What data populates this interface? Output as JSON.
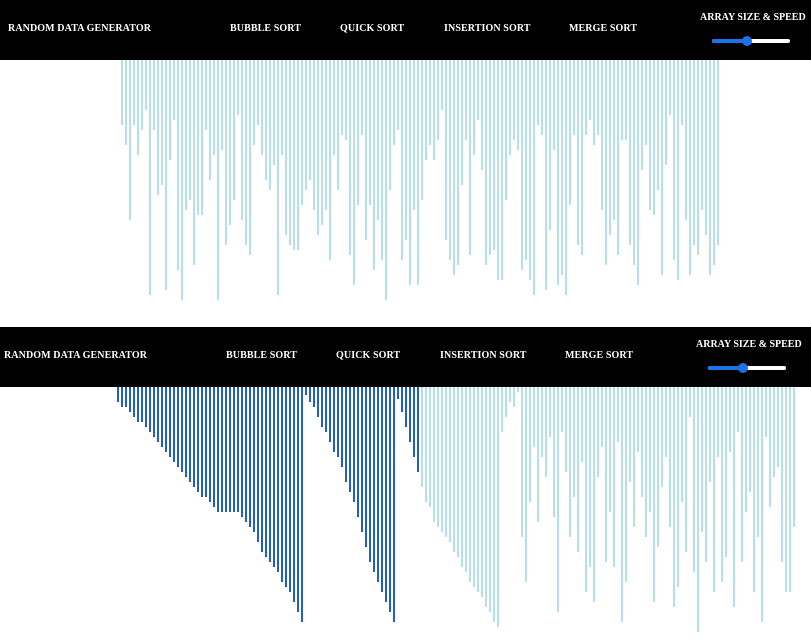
{
  "colors": {
    "navbar_bg": "#000000",
    "nav_text": "#ffffff",
    "bar_unsorted": "#b5e0ea",
    "bar_sorted": "#1f5fc6",
    "slider_accent": "#1a73e8",
    "slider_track": "#ffffff"
  },
  "nav": {
    "generator_label": "RANDOM DATA GENERATOR",
    "bubble_label": "BUBBLE SORT",
    "quick_label": "QUICK SORT",
    "insertion_label": "INSERTION SORT",
    "merge_label": "MERGE SORT",
    "controls_label": "ARRAY SIZE & SPEED"
  },
  "panels": [
    {
      "slider_value": 0.45,
      "sorted_count": 0,
      "bars": [
        65,
        85,
        160,
        65,
        95,
        70,
        50,
        235,
        70,
        135,
        125,
        230,
        100,
        60,
        210,
        240,
        150,
        140,
        205,
        155,
        155,
        70,
        120,
        95,
        240,
        90,
        185,
        165,
        140,
        55,
        160,
        185,
        195,
        85,
        65,
        95,
        120,
        130,
        105,
        235,
        95,
        175,
        185,
        190,
        190,
        145,
        130,
        120,
        150,
        175,
        165,
        150,
        200,
        95,
        130,
        75,
        80,
        195,
        225,
        145,
        75,
        180,
        145,
        210,
        160,
        200,
        240,
        130,
        85,
        70,
        200,
        180,
        225,
        150,
        225,
        140,
        100,
        85,
        100,
        80,
        50,
        180,
        200,
        215,
        205,
        125,
        80,
        195,
        95,
        60,
        110,
        205,
        195,
        190,
        220,
        220,
        140,
        95,
        80,
        90,
        210,
        200,
        220,
        235,
        65,
        75,
        230,
        170,
        90,
        225,
        215,
        235,
        145,
        75,
        185,
        195,
        75,
        60,
        85,
        75,
        150,
        205,
        175,
        160,
        195,
        80,
        80,
        185,
        205,
        225,
        110,
        85,
        150,
        155,
        130,
        215,
        105,
        55,
        200,
        220,
        65,
        160,
        215,
        185,
        195,
        150,
        175,
        215,
        205,
        185
      ]
    },
    {
      "slider_value": 0.45,
      "sorted_count": 76,
      "bars": [
        15,
        20,
        20,
        25,
        30,
        35,
        35,
        40,
        45,
        50,
        55,
        60,
        65,
        70,
        75,
        80,
        85,
        90,
        95,
        100,
        105,
        110,
        110,
        115,
        120,
        125,
        125,
        125,
        125,
        125,
        125,
        130,
        135,
        140,
        145,
        155,
        165,
        170,
        175,
        180,
        185,
        195,
        200,
        205,
        215,
        225,
        235,
        8,
        15,
        20,
        30,
        40,
        45,
        55,
        65,
        70,
        80,
        95,
        105,
        115,
        130,
        145,
        160,
        175,
        185,
        195,
        205,
        215,
        225,
        235,
        12,
        25,
        40,
        55,
        70,
        85,
        100,
        115,
        120,
        135,
        140,
        145,
        150,
        155,
        165,
        170,
        180,
        185,
        195,
        200,
        205,
        210,
        220,
        225,
        235,
        240,
        45,
        30,
        15,
        20,
        5,
        150,
        195,
        115,
        60,
        135,
        70,
        90,
        50,
        130,
        225,
        45,
        85,
        150,
        110,
        165,
        75,
        205,
        180,
        215,
        90,
        60,
        175,
        125,
        180,
        55,
        235,
        195,
        95,
        140,
        65,
        110,
        150,
        125,
        215,
        160,
        100,
        70,
        140,
        220,
        200,
        115,
        165,
        30,
        185,
        245,
        145,
        175,
        95,
        205,
        70,
        195,
        170,
        65,
        220,
        45,
        175,
        125,
        105,
        205,
        150,
        235,
        50,
        120,
        90,
        80,
        175,
        205,
        205,
        140
      ]
    }
  ]
}
